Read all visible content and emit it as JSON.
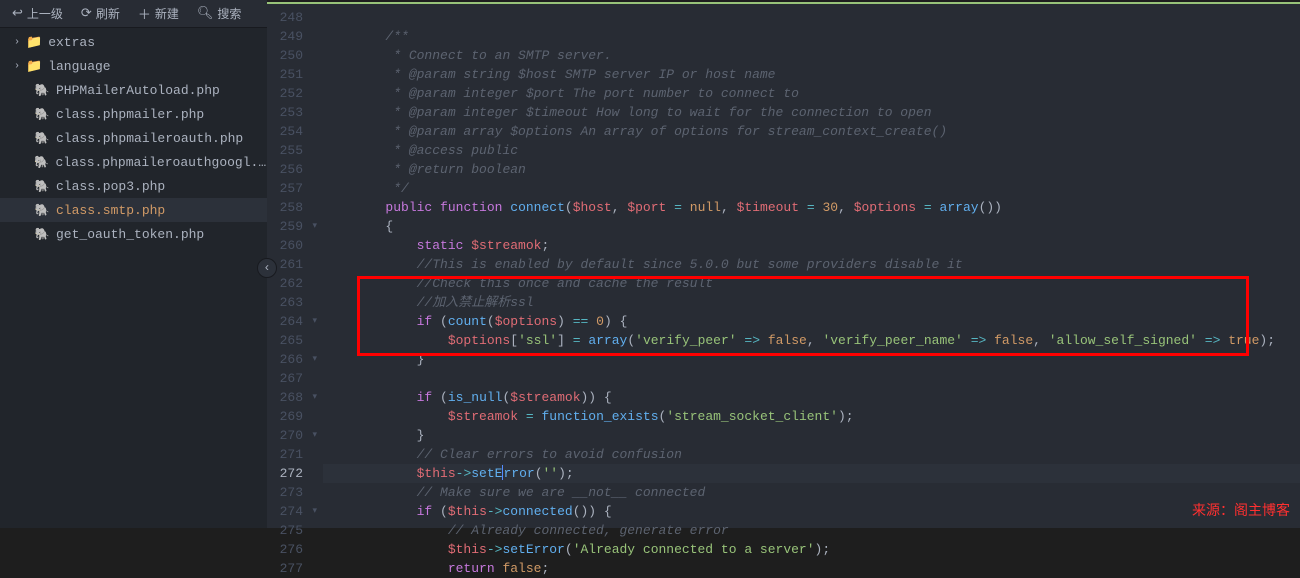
{
  "toolbar": {
    "up": "上一级",
    "refresh": "刷新",
    "new": "新建",
    "search": "搜索"
  },
  "tree": {
    "folders": [
      {
        "name": "extras"
      },
      {
        "name": "language"
      }
    ],
    "files": [
      "PHPMailerAutoload.php",
      "class.phpmailer.php",
      "class.phpmaileroauth.php",
      "class.phpmaileroauthgoogl...",
      "class.pop3.php",
      "class.smtp.php",
      "get_oauth_token.php"
    ],
    "selected": "class.smtp.php"
  },
  "gutter": {
    "start": 248,
    "end": 277,
    "highlighted": 272,
    "fold_lines": [
      259,
      264,
      266,
      268,
      270,
      274
    ]
  },
  "code": {
    "comment_block": [
      "/**",
      " * Connect to an SMTP server.",
      " * @param string $host SMTP server IP or host name",
      " * @param integer $port The port number to connect to",
      " * @param integer $timeout How long to wait for the connection to open",
      " * @param array $options An array of options for stream_context_create()",
      " * @access public",
      " * @return boolean",
      " */"
    ],
    "fn_public": "public",
    "fn_function": "function",
    "fn_name": "connect",
    "fn_params": {
      "host": "$host",
      "port": "$port",
      "null": "null",
      "timeout": "$timeout",
      "t30": "30",
      "options": "$options",
      "array": "array"
    },
    "static_kw": "static",
    "streamok": "$streamok",
    "cm_enabled": "//This is enabled by default since 5.0.0 but some providers disable it",
    "cm_check": "//Check this once and cache the result",
    "cm_ssl": "//加入禁止解析ssl",
    "if_kw": "if",
    "count_fn": "count",
    "options_var": "$options",
    "eq0": "0",
    "ssl_key": "'ssl'",
    "array_kw": "array",
    "vp": "'verify_peer'",
    "false_kw": "false",
    "vpn": "'verify_peer_name'",
    "ass": "'allow_self_signed'",
    "true_kw": "true",
    "is_null": "is_null",
    "fexists": "function_exists",
    "ssc": "'stream_socket_client'",
    "cm_clear": "// Clear errors to avoid confusion",
    "this_kw": "$this",
    "setError": "setError",
    "empty_str": "''",
    "cm_notconn": "// Make sure we are __not__ connected",
    "connected": "connected",
    "cm_already": "// Already connected, generate error",
    "already_str": "'Already connected to a server'",
    "return_kw": "return"
  },
  "watermark": "来源：阁主博客"
}
